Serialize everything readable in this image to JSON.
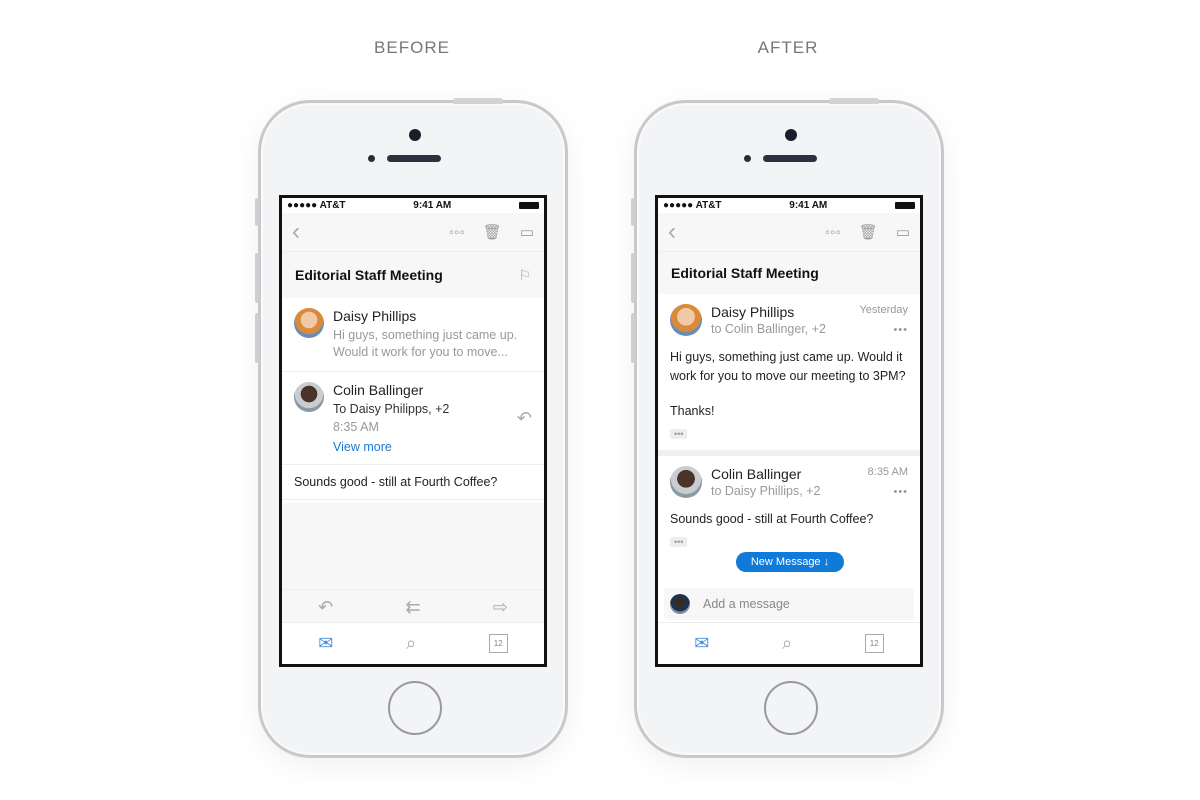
{
  "labels": {
    "before": "BEFORE",
    "after": "AFTER"
  },
  "status": {
    "carrier": "●●●●● AT&T",
    "wifi": "wifi-icon",
    "time": "9:41 AM"
  },
  "toolbar": {
    "back": "‹",
    "more": "◦◦◦",
    "delete": "🗑",
    "archive": "▭"
  },
  "subject": "Editorial Staff Meeting",
  "before": {
    "messages": [
      {
        "name": "Daisy Phillips",
        "preview": "Hi guys, something just came up. Would it work for you to move..."
      },
      {
        "name": "Colin Ballinger",
        "to": "To Daisy Philipps, +2",
        "time": "8:35 AM",
        "link": "View more"
      }
    ],
    "reply_body": "Sounds good - still at Fourth Coffee?",
    "actions": {
      "reply": "↶",
      "reply_all": "⇇",
      "forward": "⇨"
    }
  },
  "after": {
    "messages": [
      {
        "name": "Daisy Phillips",
        "to": "to Colin Ballinger, +2",
        "time": "Yesterday",
        "more": "•••",
        "body_line1": "Hi guys, something just came up. Would it work for you to move our meeting to 3PM?",
        "body_line2": "Thanks!",
        "ellipsis": "•••"
      },
      {
        "name": "Colin Ballinger",
        "to": "to Daisy Phillips, +2",
        "time": "8:35 AM",
        "more": "•••",
        "body_line1": "Sounds good - still at Fourth Coffee?",
        "ellipsis": "•••"
      }
    ],
    "new_message": "New Message ↓",
    "compose_placeholder": "Add a message"
  },
  "tabs": {
    "mail": "✉",
    "search": "⌕",
    "calendar": "12"
  },
  "colors": {
    "accent": "#0f7ad8",
    "link": "#1a7ad4"
  }
}
